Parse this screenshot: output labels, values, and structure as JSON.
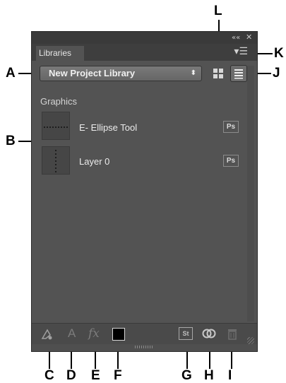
{
  "panel": {
    "titlebar": {
      "collapse_glyph": "««",
      "close_glyph": "✕"
    },
    "tab_label": "Libraries",
    "flyout_glyph": "▾☰",
    "library_select": {
      "value": "New Project Library",
      "arrow": "⬍"
    },
    "view_buttons": {
      "grid_icon": "grid-view-icon",
      "list_icon": "list-view-icon",
      "active": "list"
    },
    "section_title": "Graphics",
    "items": [
      {
        "label": "E- Ellipse Tool",
        "badge": "Ps"
      },
      {
        "label": "Layer 0",
        "badge": "Ps"
      }
    ],
    "bottom_bar": {
      "text_icon": "A",
      "fx_icon": "fx",
      "stock_icon": "St",
      "color_swatch": "#000000"
    }
  },
  "callouts": {
    "A": "A",
    "B": "B",
    "C": "C",
    "D": "D",
    "E": "E",
    "F": "F",
    "G": "G",
    "H": "H",
    "I": "I",
    "J": "J",
    "K": "K",
    "L": "L"
  },
  "colors": {
    "panel_bg": "#535353",
    "titlebar_bg": "#3a3a3a",
    "text": "#ececec"
  }
}
